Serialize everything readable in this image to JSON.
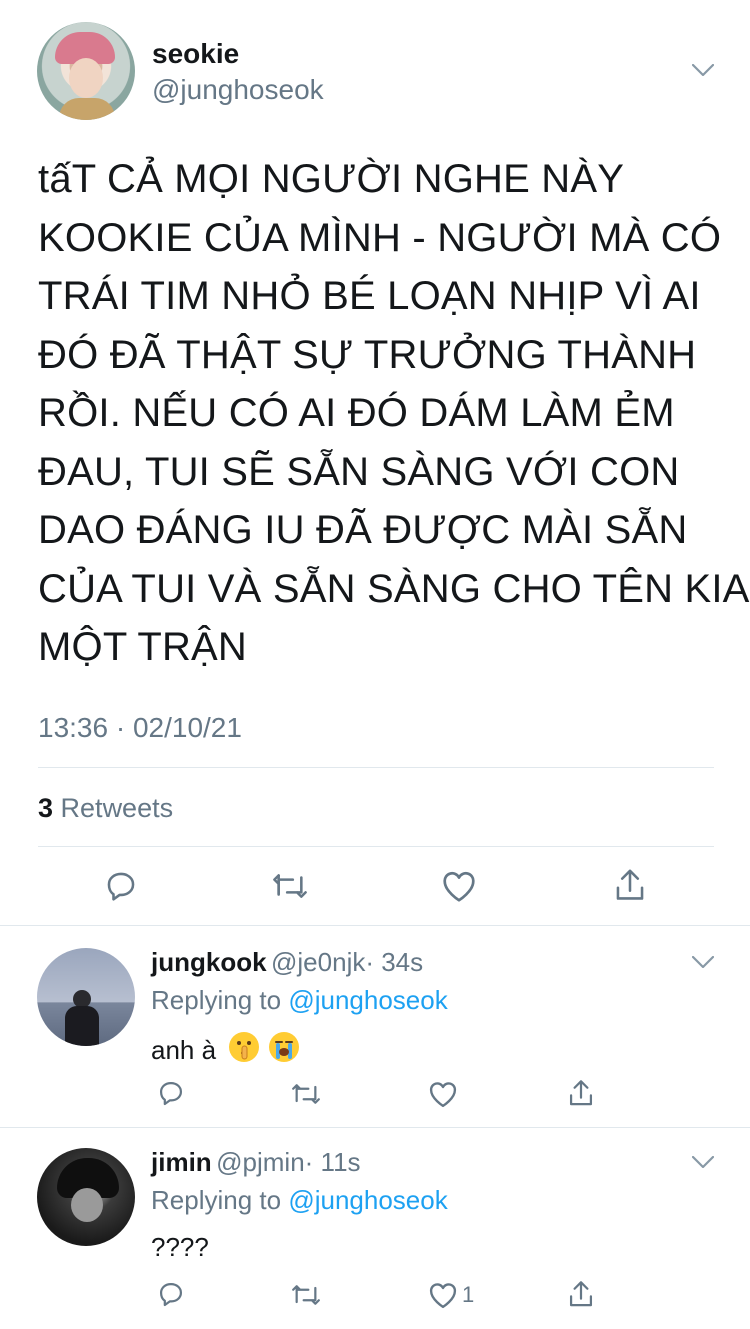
{
  "main_tweet": {
    "display_name": "seokie",
    "handle": "@junghoseok",
    "text_lines": [
      "tấT CẢ MỌI NGƯỜI NGHE NÀY",
      "KOOKIE CỦA MÌNH - NGƯỜI MÀ CÓ",
      "TRÁI TIM NHỎ BÉ LOẠN NHỊP VÌ AI",
      "ĐÓ ĐÃ THẬT SỰ TRƯỞNG THÀNH",
      "RỒI. NẾU CÓ AI ĐÓ DÁM LÀM ẺM",
      "ĐAU, TUI SẼ SẴN SÀNG VỚI CON",
      "DAO ĐÁNG IU ĐÃ ĐƯỢC MÀI SẴN",
      "CỦA TUI VÀ SẴN SÀNG CHO TÊN KIA",
      "MỘT TRẬN"
    ],
    "timestamp": "13:36 · 02/10/21",
    "retweet_count": "3",
    "retweet_label": "Retweets"
  },
  "replies": [
    {
      "display_name": "jungkook",
      "handle": "@je0njk",
      "time": "· 34s",
      "replying_prefix": "Replying to",
      "replying_handle": "@junghoseok",
      "text": "anh à",
      "emojis": [
        "shushing-face",
        "loudly-crying-face"
      ],
      "like_count": ""
    },
    {
      "display_name": "jimin",
      "handle": "@pjmin",
      "time": "· 11s",
      "replying_prefix": "Replying to",
      "replying_handle": "@junghoseok",
      "text": "????",
      "like_count": "1"
    }
  ],
  "icons": [
    "chevron-down-icon",
    "reply-icon",
    "retweet-icon",
    "like-icon",
    "share-icon"
  ],
  "colors": {
    "link": "#1da1f2",
    "muted": "#657786",
    "divider": "#e1e8ed",
    "text": "#14171a"
  }
}
